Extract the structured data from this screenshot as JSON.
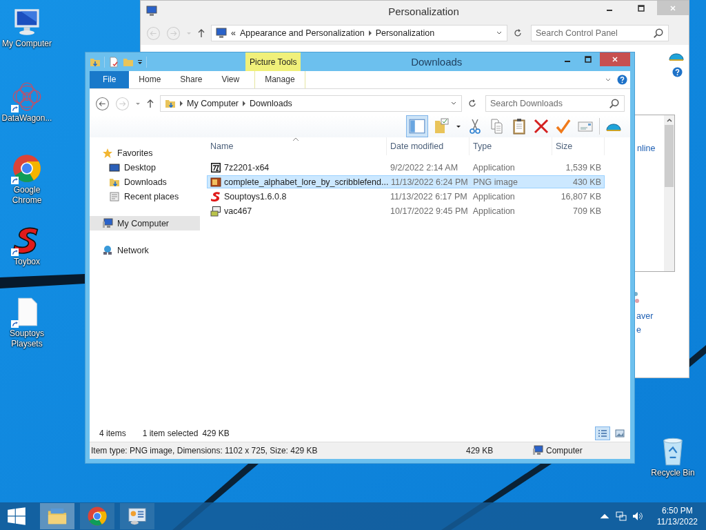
{
  "desktop_icons": [
    {
      "label": "My Computer",
      "kind": "computer",
      "shortcut": false
    },
    {
      "label": "DataWagon...",
      "kind": "flower",
      "shortcut": true
    },
    {
      "label": "Google Chrome",
      "kind": "chrome",
      "shortcut": true
    },
    {
      "label": "Toybox",
      "kind": "letter_s",
      "shortcut": true
    },
    {
      "label": "Souptoys Playsets",
      "kind": "file",
      "shortcut": true
    }
  ],
  "recycle_bin": {
    "label": "Recycle Bin"
  },
  "background_window": {
    "title": "Personalization",
    "address_prefix": "«",
    "address": [
      "Appearance and Personalization",
      "Personalization"
    ],
    "search": {
      "placeholder": "Search Control Panel"
    },
    "link_fragment": "nline",
    "label_fragments": [
      "aver",
      "e"
    ]
  },
  "window": {
    "title": "Downloads",
    "contextual_group": "Picture Tools",
    "tabs": [
      {
        "label": "File",
        "kind": "file"
      },
      {
        "label": "Home",
        "kind": "plain"
      },
      {
        "label": "Share",
        "kind": "plain"
      },
      {
        "label": "View",
        "kind": "plain"
      },
      {
        "label": "Manage",
        "kind": "contextual"
      }
    ],
    "address": [
      "My Computer",
      "Downloads"
    ],
    "search": {
      "placeholder": "Search Downloads"
    },
    "nav": [
      {
        "label": "Favorites",
        "kind": "star",
        "selected": false,
        "children": [
          {
            "label": "Desktop",
            "kind": "desktop",
            "selected": false
          },
          {
            "label": "Downloads",
            "kind": "downloads",
            "selected": false
          },
          {
            "label": "Recent places",
            "kind": "recent",
            "selected": false
          }
        ]
      },
      {
        "label": "My Computer",
        "kind": "computer",
        "selected": true
      },
      {
        "label": "Network",
        "kind": "network",
        "selected": false
      }
    ],
    "columns": [
      "Name",
      "Date modified",
      "Type",
      "Size"
    ],
    "rows": [
      {
        "name": "7z2201-x64",
        "kind": "sevenzip",
        "date": "9/2/2022 2:14 AM",
        "type": "Application",
        "size": "1,539 KB",
        "selected": false
      },
      {
        "name": "complete_alphabet_lore_by_scribblefend...",
        "kind": "image",
        "date": "11/13/2022 6:24 PM",
        "type": "PNG image",
        "size": "430 KB",
        "selected": true
      },
      {
        "name": "Souptoys1.6.0.8",
        "kind": "letter_s",
        "date": "11/13/2022 6:17 PM",
        "type": "Application",
        "size": "16,807 KB",
        "selected": false
      },
      {
        "name": "vac467",
        "kind": "setup",
        "date": "10/17/2022 9:45 PM",
        "type": "Application",
        "size": "709 KB",
        "selected": false
      }
    ],
    "status": {
      "items": "4 items",
      "selection": "1 item selected",
      "selection_size": "429 KB"
    },
    "views": [
      {
        "kind": "details",
        "selected": true
      },
      {
        "kind": "large",
        "selected": false
      }
    ],
    "details_bar": {
      "info": "Item type: PNG image, Dimensions: 1102 x 725, Size: 429 KB",
      "size": "429 KB",
      "location": "Computer"
    }
  },
  "taskbar": {
    "apps": [
      {
        "kind": "explorer",
        "selected": true
      },
      {
        "kind": "chrome",
        "selected": false
      },
      {
        "kind": "control_panel",
        "selected": false
      }
    ],
    "time": "6:50 PM",
    "date": "11/13/2022"
  }
}
